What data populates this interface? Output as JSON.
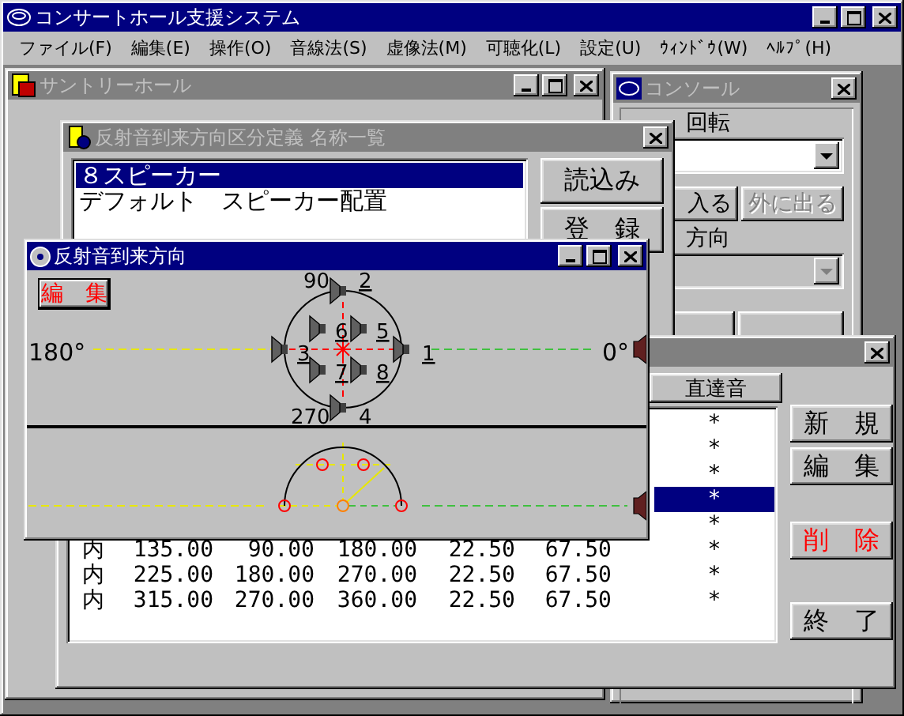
{
  "app": {
    "title": "コンサートホール支援システム",
    "active": true
  },
  "menu": [
    "ファイル(F)",
    "編集(E)",
    "操作(O)",
    "音線法(S)",
    "虚像法(M)",
    "可聴化(L)",
    "設定(U)",
    "ｳｨﾝﾄﾞｳ(W)",
    "ﾍﾙﾌﾟ(H)"
  ],
  "hall_window": {
    "title": "サントリーホール",
    "active": false
  },
  "console": {
    "title": "コンソール",
    "active": false,
    "rotation_label": "回転",
    "rotation_dropdown": {
      "disabled": false
    },
    "buttons": [
      {
        "label": "入る",
        "disabled": false
      },
      {
        "label": "外に出る",
        "disabled": true
      }
    ],
    "direction_label": "方向",
    "direction_dropdown": {
      "disabled": true
    }
  },
  "name_list_window": {
    "title": "反射音到来方向区分定義 名称一覧",
    "active": false,
    "items": [
      {
        "label": "８スピーカー",
        "selected": true
      },
      {
        "label": "デフォルト　スピーカー配置",
        "selected": false
      }
    ],
    "buttons": [
      "読込み",
      "登　録"
    ]
  },
  "table_window": {
    "active": false,
    "header": "直達音",
    "rows": [
      {
        "direct": "*",
        "selected": false
      },
      {
        "direct": "*",
        "selected": false
      },
      {
        "direct": "*",
        "selected": false
      },
      {
        "direct": "*",
        "selected": true
      },
      {
        "direct": "*",
        "selected": false
      },
      {
        "cells": [
          "内",
          "135.00",
          "90.00",
          "180.00",
          "22.50",
          "67.50"
        ],
        "direct": "*",
        "selected": false
      },
      {
        "cells": [
          "内",
          "225.00",
          "180.00",
          "270.00",
          "22.50",
          "67.50"
        ],
        "direct": "*",
        "selected": false
      },
      {
        "cells": [
          "内",
          "315.00",
          "270.00",
          "360.00",
          "22.50",
          "67.50"
        ],
        "direct": "*",
        "selected": false
      }
    ],
    "buttons": [
      {
        "label": "新　規",
        "kind": "normal"
      },
      {
        "label": "編　集",
        "kind": "normal"
      },
      {
        "label": "削　除",
        "kind": "danger"
      },
      {
        "label": "終　了",
        "kind": "normal"
      }
    ]
  },
  "direction_window": {
    "title": "反射音到来方向",
    "active": true,
    "edit_button": "編　集",
    "left_label": "180°",
    "right_label": "0°",
    "top_label": "90",
    "bottom_label": "270",
    "speakers": [
      "1",
      "2",
      "3",
      "4",
      "5",
      "6",
      "7",
      "8"
    ]
  }
}
